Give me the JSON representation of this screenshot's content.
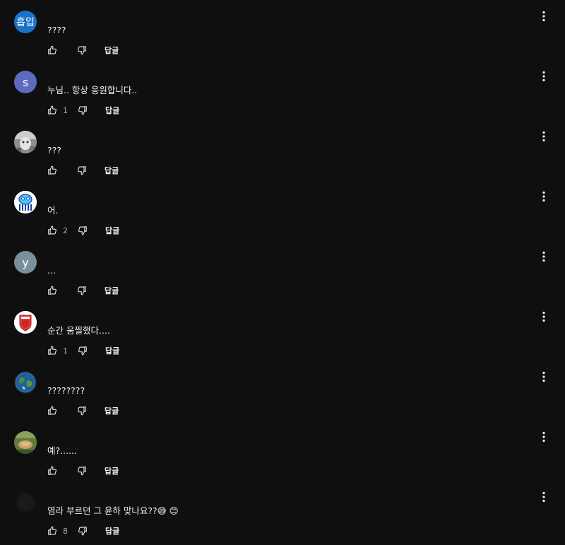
{
  "comments": [
    {
      "avatar_text": "흡입",
      "avatar_color": "#1a73c8",
      "avatar_icon": "",
      "text": "????",
      "likes": "",
      "reply_label": "답글"
    },
    {
      "avatar_text": "s",
      "avatar_color": "#5c6bc0",
      "avatar_icon": "",
      "text": "누님.. 항상 응원합니다..",
      "likes": "1",
      "reply_label": "답글"
    },
    {
      "avatar_text": "",
      "avatar_color": "#9a9a9a",
      "avatar_icon": "photo-avatar-icon",
      "text": "???",
      "likes": "",
      "reply_label": "답글"
    },
    {
      "avatar_text": "",
      "avatar_color": "#ffffff",
      "avatar_icon": "cartoon-avatar-icon",
      "text": "어.",
      "likes": "2",
      "reply_label": "답글"
    },
    {
      "avatar_text": "y",
      "avatar_color": "#78909c",
      "avatar_icon": "",
      "text": "...",
      "likes": "",
      "reply_label": "답글"
    },
    {
      "avatar_text": "",
      "avatar_color": "#ffffff",
      "avatar_icon": "shield-avatar-icon",
      "text": "순간 움찔했다....",
      "likes": "1",
      "reply_label": "답글"
    },
    {
      "avatar_text": "",
      "avatar_color": "#1c3a5e",
      "avatar_icon": "earth-avatar-icon",
      "text": "????????",
      "likes": "",
      "reply_label": "답글"
    },
    {
      "avatar_text": "",
      "avatar_color": "#6b7b3a",
      "avatar_icon": "photo-avatar-icon",
      "text": "예?......",
      "likes": "",
      "reply_label": "답글"
    },
    {
      "avatar_text": "",
      "avatar_color": "#141414",
      "avatar_icon": "dark-avatar-icon",
      "text": "염라 부르던 그 윤하 맞나요??😅 😊",
      "likes": "8",
      "reply_label": "답글"
    }
  ]
}
